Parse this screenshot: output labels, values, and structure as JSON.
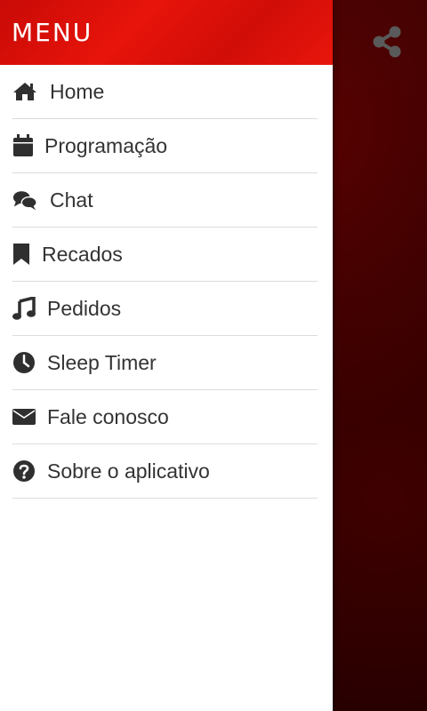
{
  "colors": {
    "header_red": "#e0120a",
    "icon_dark": "#2f2f2f",
    "text": "#333333",
    "divider": "#dcdcdc",
    "backdrop": "#2a0000",
    "share_icon": "#5a5a5a"
  },
  "header": {
    "share_icon": "share-icon"
  },
  "drawer": {
    "title": "MENU",
    "items": [
      {
        "label": "Home",
        "icon": "home-icon"
      },
      {
        "label": "Programação",
        "icon": "calendar-icon"
      },
      {
        "label": "Chat",
        "icon": "chat-icon"
      },
      {
        "label": "Recados",
        "icon": "bookmark-icon"
      },
      {
        "label": "Pedidos",
        "icon": "music-note-icon"
      },
      {
        "label": "Sleep Timer",
        "icon": "clock-icon"
      },
      {
        "label": "Fale conosco",
        "icon": "envelope-icon"
      },
      {
        "label": "Sobre o aplicativo",
        "icon": "question-circle-icon"
      }
    ]
  }
}
